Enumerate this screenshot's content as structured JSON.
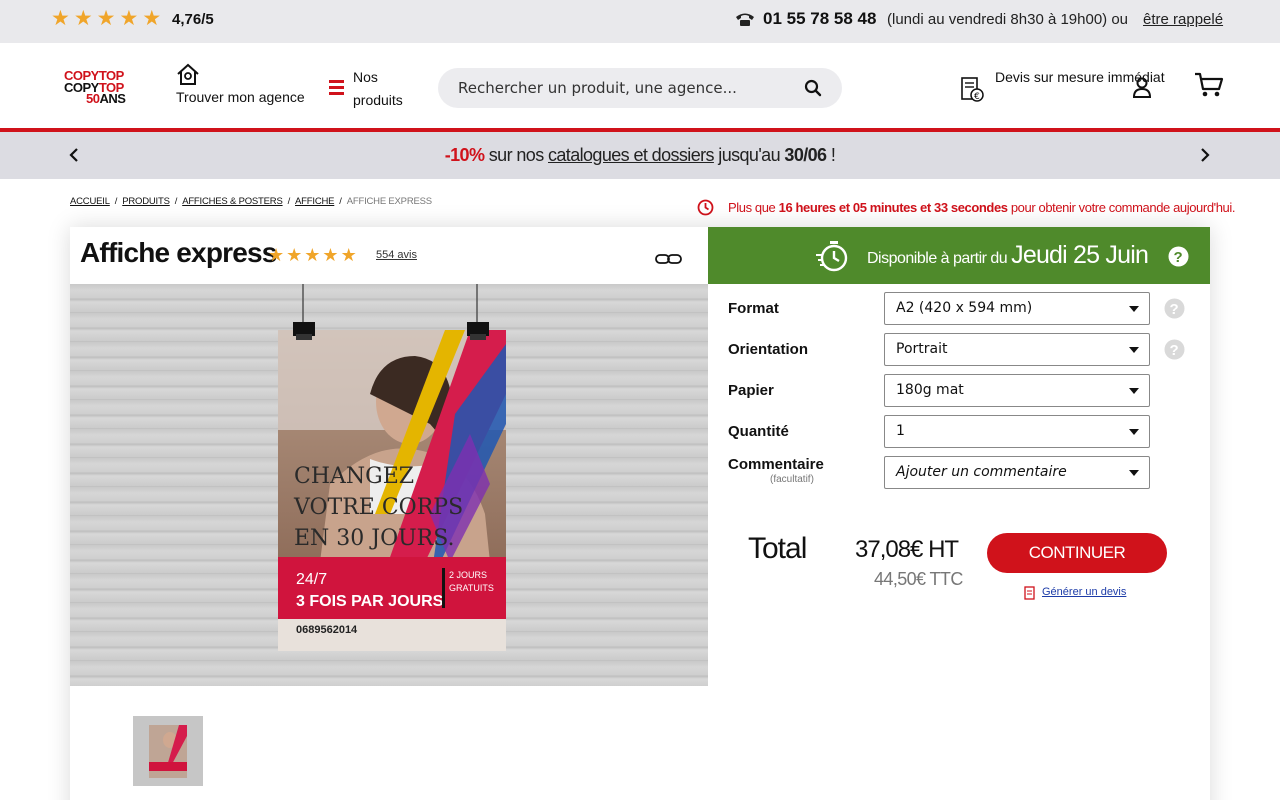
{
  "topbar": {
    "rating": "4,76/5",
    "phone": "01 55 78 58 48",
    "hours": "(lundi au vendredi 8h30 à 19h00) ou",
    "callback": "être rappelé"
  },
  "header": {
    "logo": {
      "line1": "COPYTOP",
      "line2a": "COPY",
      "line2b": "TOP",
      "line3a": "50",
      "line3b": "ANS"
    },
    "agency": "Trouver mon agence",
    "menu": "Nos produits",
    "search_placeholder": "Rechercher un produit, une agence...",
    "devis": "Devis sur mesure immédiat"
  },
  "promo": {
    "pct": "-10%",
    "t1": " sur nos ",
    "link": "catalogues et dossiers",
    "t2": " jusqu'au ",
    "date": "30/06",
    "t3": " !"
  },
  "breadcrumb": {
    "items": [
      "ACCUEIL",
      "PRODUITS",
      "AFFICHES & POSTERS",
      "AFFICHE"
    ],
    "current": "AFFICHE EXPRESS"
  },
  "timer": {
    "t1": "Plus que ",
    "hours": "16 heures et 05 minutes et 33 secondes",
    "t2": " pour obtenir votre commande aujourd'hui."
  },
  "product": {
    "title": "Affiche express",
    "rating": 5,
    "reviews": "554 avis"
  },
  "poster": {
    "line1": "CHANGEZ",
    "line2": "VOTRE CORPS",
    "line3": "EN 30 JOURS.",
    "band1": "24/7",
    "band2": "3 FOIS PAR JOURS",
    "band3": "2 JOURS",
    "band4": "GRATUITS",
    "phone": "0689562014"
  },
  "delivery": {
    "text": "Disponible à partir du ",
    "date": "Jeudi 25 Juin"
  },
  "form": {
    "format_label": "Format",
    "format_value": "A2 (420 x 594 mm)",
    "orientation_label": "Orientation",
    "orientation_value": "Portrait",
    "paper_label": "Papier",
    "paper_value": "180g mat",
    "quantity_label": "Quantité",
    "quantity_value": "1",
    "comment_label": "Commentaire",
    "comment_optional": "(facultatif)",
    "comment_value": "Ajouter un commentaire"
  },
  "total": {
    "label": "Total",
    "ht": "37,08€ HT",
    "ttc": "44,50€ TTC",
    "continue": "CONTINUER",
    "quote": "Générer un devis"
  },
  "colors": {
    "brand_red": "#d0121b",
    "delivery_green": "#4f8a2b",
    "star": "#f0a52a",
    "link_blue": "#1d3ca8"
  }
}
